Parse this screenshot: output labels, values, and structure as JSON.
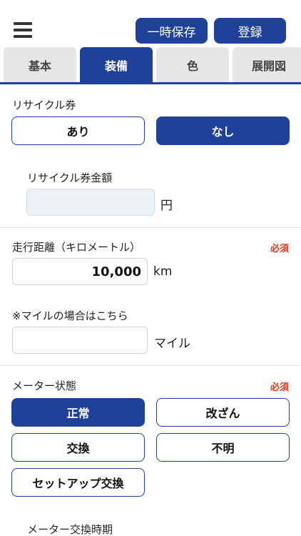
{
  "header": {
    "menu_icon": "hamburger-icon",
    "temp_save_label": "一時保存",
    "register_label": "登録"
  },
  "tabs": [
    {
      "label": "基本",
      "active": false
    },
    {
      "label": "装備",
      "active": true
    },
    {
      "label": "色",
      "active": false
    },
    {
      "label": "展開図",
      "active": false
    }
  ],
  "recycle": {
    "label": "リサイクル券",
    "options": [
      {
        "label": "あり",
        "selected": false
      },
      {
        "label": "なし",
        "selected": true
      }
    ],
    "amount_label": "リサイクル券金額",
    "amount_value": "",
    "amount_unit": "円"
  },
  "mileage": {
    "label": "走行距離（キロメートル）",
    "required": "必須",
    "value": "10,000",
    "unit": "km",
    "mile_note": "※マイルの場合はこちら",
    "mile_value": "",
    "mile_unit": "マイル"
  },
  "meter": {
    "label": "メーター状態",
    "required": "必須",
    "options": [
      {
        "label": "正常",
        "selected": true
      },
      {
        "label": "改ざん",
        "selected": false
      },
      {
        "label": "交換",
        "selected": false
      },
      {
        "label": "不明",
        "selected": false
      },
      {
        "label": "セットアップ交換",
        "selected": false
      }
    ],
    "exchange_label": "メーター交換時期"
  },
  "colors": {
    "primary": "#1f4199",
    "required": "#d9381e",
    "tab_inactive": "#e6e6e6"
  }
}
